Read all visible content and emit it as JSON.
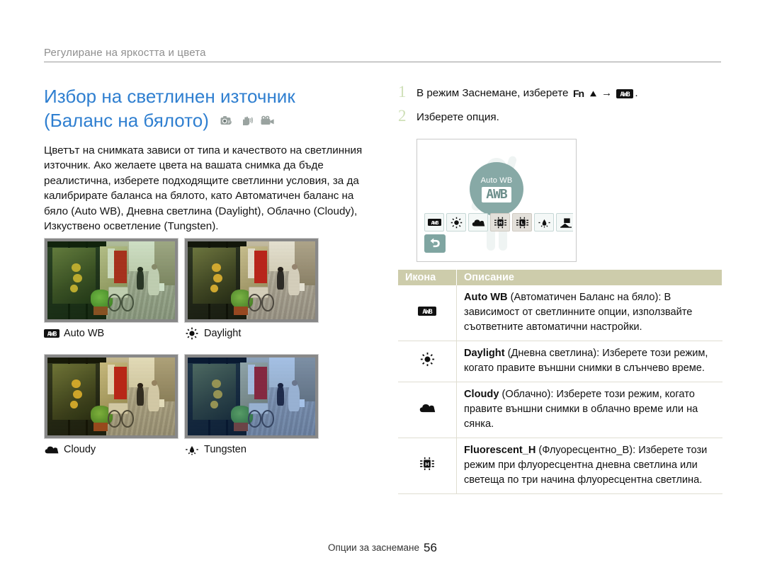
{
  "runhead": {
    "text": "Регулиране на яркостта и цвета"
  },
  "title": {
    "line1": "Избор на светлинен източник",
    "line2": "(Баланс на бялото)",
    "mode_icons": [
      "camera-p-icon",
      "hand-shake-icon",
      "video-camera-icon"
    ]
  },
  "body": {
    "paragraph": "Цветът на снимката зависи от типа и качеството на светлинния източник. Ако желаете цвета на вашата снимка да бъде реалистична, изберете подходящите светлинни условия, за да калибрирате баланса на бялото, като Автоматичен баланс на бяло (Auto WB), Дневна светлина (Daylight), Облачно (Cloudy), Изкуствено осветление (Tungsten)."
  },
  "samples": [
    {
      "caption": "Auto WB",
      "icon": "awb-icon"
    },
    {
      "caption": "Daylight",
      "icon": "sun-icon"
    },
    {
      "caption": "Cloudy",
      "icon": "cloud-icon"
    },
    {
      "caption": "Tungsten",
      "icon": "tungsten-icon"
    }
  ],
  "steps": [
    {
      "num": "1",
      "pre": "В режим Заснемане, изберете",
      "fn": "Fn",
      "arrow": "→",
      "post": "."
    },
    {
      "num": "2",
      "text": "Изберете опция."
    }
  ],
  "screen": {
    "badge_label": "Auto WB",
    "badge_code": "AWB",
    "buttons": [
      "awb-icon",
      "sun-icon",
      "cloud-icon",
      "fluorescent-h-icon",
      "fluorescent-l-icon",
      "tungsten-icon",
      "custom-wb-icon"
    ],
    "selected_index": 3,
    "back_button": "back-arrow-icon"
  },
  "table": {
    "headers": [
      "Икона",
      "Описание"
    ],
    "rows": [
      {
        "icon": "awb-icon",
        "bold": "Auto WB",
        "rest": " (Автоматичен Баланс на бяло):",
        "desc": "В зависимост от светлинните опции, използвайте съответните автоматични настройки."
      },
      {
        "icon": "sun-icon",
        "bold": "Daylight",
        "rest": " (Дневна светлина): Изберете този",
        "desc": "режим, когато правите външни снимки в слънчево време."
      },
      {
        "icon": "cloud-icon",
        "bold": "Cloudy",
        "rest": " (Облачно): Изберете този режим, когато",
        "desc": "правите външни снимки в облачно време или на сянка."
      },
      {
        "icon": "fluorescent-h-icon",
        "bold": "Fluorescent_H",
        "rest": " (Флуоресцентно_В): Изберете",
        "desc": "този режим при флуоресцентна дневна светлина или светеща по три начина флуоресцентна светлина."
      }
    ]
  },
  "footer": {
    "text": "Опции за заснемане",
    "page": "56"
  },
  "colors": {
    "title": "#2f7fd0",
    "runhead": "#8f8f8f",
    "table_header_bg": "#cdccab",
    "badge_bg": "#87a9a6",
    "step_num": "#cfe0b8"
  }
}
